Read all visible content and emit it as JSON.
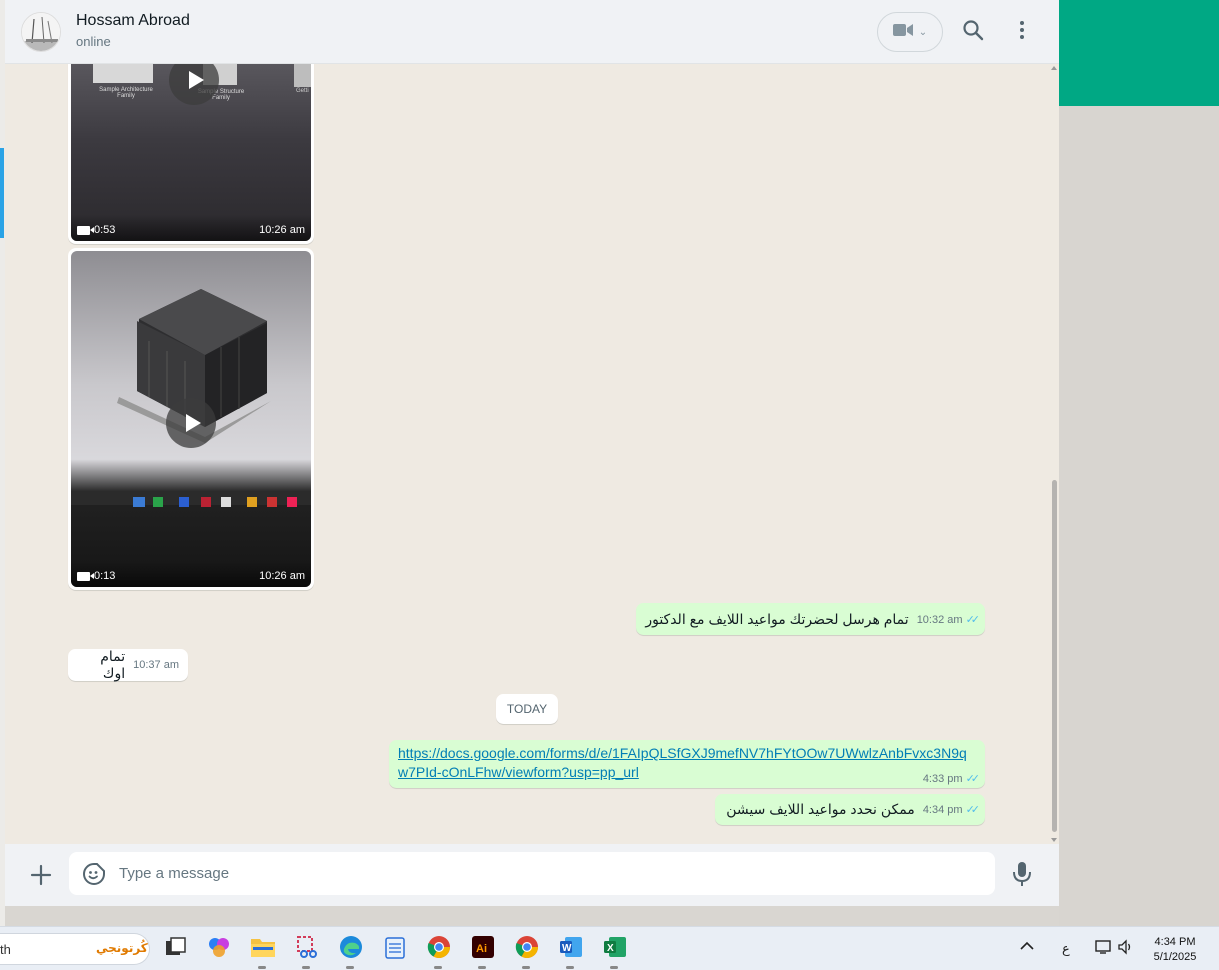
{
  "header": {
    "contact_name": "Hossam Abroad",
    "contact_status": "online",
    "icons": [
      "video-call-icon",
      "search-icon",
      "menu-icon"
    ]
  },
  "videos": [
    {
      "duration": "0:53",
      "time": "10:26 am",
      "caption_left": "Sample Architecture Family",
      "caption_mid": "Sample Structure Family",
      "caption_right": "Getti"
    },
    {
      "duration": "0:13",
      "time": "10:26 am"
    }
  ],
  "messages": [
    {
      "direction": "out",
      "text": "تمام هرسل لحضرتك مواعيد اللايف مع الدكتور",
      "time": "10:32 am"
    },
    {
      "direction": "in",
      "text": "تمام اوك",
      "time": "10:37 am"
    },
    {
      "direction": "out",
      "link": "https://docs.google.com/forms/d/e/1FAIpQLSfGXJ9mefNV7hFYtOOw7UWwlzAnbFvxc3N9qw7PId-cOnLFhw/viewform?usp=pp_url",
      "time": "4:33 pm"
    },
    {
      "direction": "out",
      "text": "ممكن نحدد مواعيد اللايف سيشن",
      "time": "4:34 pm"
    }
  ],
  "date_divider": "TODAY",
  "composer": {
    "placeholder": "Type a message"
  },
  "taskbar": {
    "search_text": "th",
    "search_art": "كُرتونجي",
    "tray_lang": "ع",
    "time": "4:34 PM",
    "date": "5/1/2025"
  },
  "colors": {
    "accent": "#00a884",
    "out_bubble": "#d9fdd3",
    "link": "#027eb5",
    "read_ticks": "#53bdeb"
  }
}
